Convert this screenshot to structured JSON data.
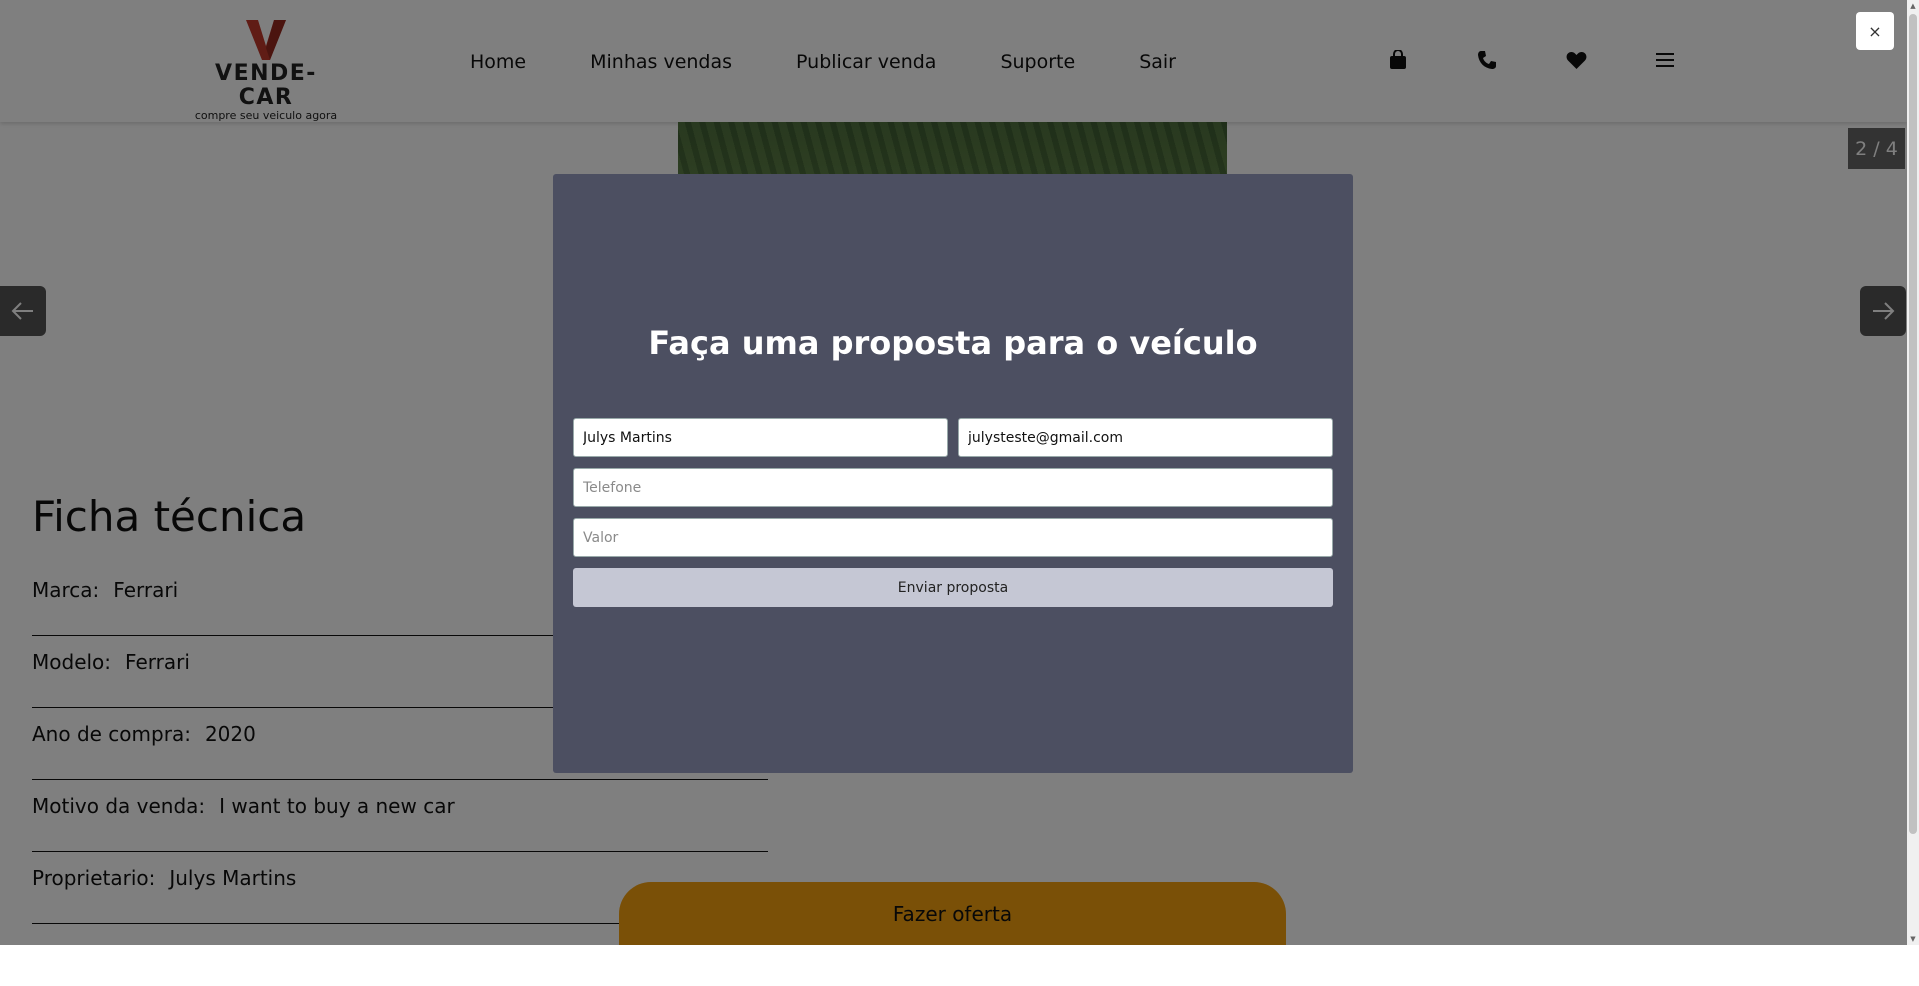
{
  "header": {
    "brand": "VENDE-CAR",
    "tagline": "compre seu veiculo agora",
    "nav": [
      "Home",
      "Minhas vendas",
      "Publicar venda",
      "Suporte",
      "Sair"
    ],
    "icons": [
      "shopping-bag-icon",
      "phone-icon",
      "heart-icon",
      "menu-icon"
    ]
  },
  "gallery": {
    "counter": "2 / 4"
  },
  "ficha": {
    "title": "Ficha técnica",
    "specs": [
      {
        "label": "Marca:",
        "value": "Ferrari"
      },
      {
        "label": "Modelo:",
        "value": "Ferrari"
      },
      {
        "label": "Ano de compra:",
        "value": "2020"
      },
      {
        "label": "Motivo da venda:",
        "value": "I want to buy a new car"
      },
      {
        "label": "Proprietario:",
        "value": "Julys Martins"
      }
    ]
  },
  "offer_button": "Fazer oferta",
  "modal": {
    "close_label": "×",
    "title": "Faça uma proposta para o veículo",
    "name_value": "Julys Martins",
    "email_value": "julysteste@gmail.com",
    "phone_placeholder": "Telefone",
    "value_placeholder": "Valor",
    "submit_label": "Enviar proposta"
  },
  "colors": {
    "modal_bg": "#4c4f61",
    "submit_bg": "#c5c7d4",
    "offer_bg": "#f4a00f",
    "logo_red": "#c0392b"
  }
}
